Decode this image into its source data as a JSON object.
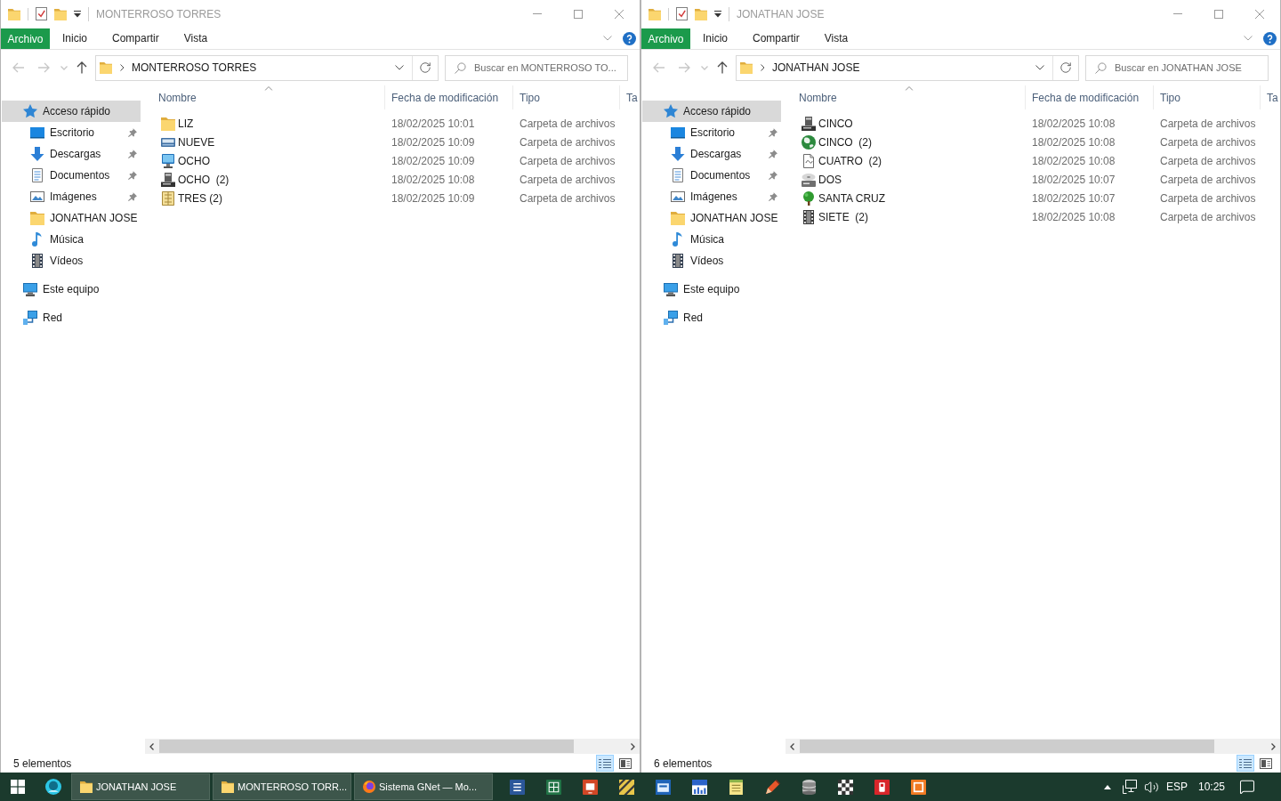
{
  "windows": [
    {
      "title": "MONTERROSO TORRES",
      "active": false,
      "ribbon_tabs": [
        {
          "label": "Archivo",
          "kind": "file"
        },
        {
          "label": "Inicio",
          "kind": "tab"
        },
        {
          "label": "Compartir",
          "kind": "tab"
        },
        {
          "label": "Vista",
          "kind": "tab"
        }
      ],
      "nav_buttons": [
        {
          "kind": "back",
          "disabled": true
        },
        {
          "kind": "forward",
          "disabled": true
        },
        {
          "kind": "recent",
          "disabled": true
        },
        {
          "kind": "up",
          "disabled": false
        }
      ],
      "address": "MONTERROSO TORRES",
      "search": {
        "placeholder": "Buscar en MONTERROSO TO..."
      },
      "navigation": [
        {
          "label": "Acceso rápido",
          "kind": "star",
          "selected": true,
          "children": [
            {
              "label": "Escritorio",
              "kind": "desktop",
              "pinned": true,
              "selected": false
            },
            {
              "label": "Descargas",
              "kind": "downloads",
              "pinned": true,
              "selected": false
            },
            {
              "label": "Documentos",
              "kind": "documents",
              "pinned": true,
              "selected": false
            },
            {
              "label": "Imágenes",
              "kind": "pictures",
              "pinned": true,
              "selected": false
            },
            {
              "label": "JONATHAN JOSE",
              "kind": "folder",
              "pinned": false,
              "selected": false
            },
            {
              "label": "Música",
              "kind": "music",
              "pinned": false,
              "selected": false
            },
            {
              "label": "Vídeos",
              "kind": "videos",
              "pinned": false,
              "selected": false
            }
          ]
        },
        {
          "label": "Este equipo",
          "kind": "pc",
          "selected": false
        },
        {
          "label": "Red",
          "kind": "network",
          "selected": false
        }
      ],
      "columns": [
        {
          "label": "Nombre",
          "sorted": true
        },
        {
          "label": "Fecha de modificación",
          "sorted": false
        },
        {
          "label": "Tipo",
          "sorted": false
        },
        {
          "label": "Ta",
          "sorted": false
        }
      ],
      "rows": [
        {
          "name": "LIZ",
          "kind": "folder",
          "date": "18/02/2025 10:01",
          "type": "Carpeta de archivos"
        },
        {
          "name": "NUEVE",
          "kind": "scanner",
          "date": "18/02/2025 10:09",
          "type": "Carpeta de archivos"
        },
        {
          "name": "OCHO",
          "kind": "monitor",
          "date": "18/02/2025 10:09",
          "type": "Carpeta de archivos"
        },
        {
          "name": "OCHO  (2)",
          "kind": "tower",
          "date": "18/02/2025 10:08",
          "type": "Carpeta de archivos"
        },
        {
          "name": "TRES (2)",
          "kind": "notebook",
          "date": "18/02/2025 10:09",
          "type": "Carpeta de archivos"
        }
      ],
      "status": "5 elementos",
      "view_buttons": [
        {
          "kind": "details",
          "selected": true
        },
        {
          "kind": "tiles",
          "selected": false
        }
      ]
    },
    {
      "title": "JONATHAN JOSE",
      "active": false,
      "ribbon_tabs": [
        {
          "label": "Archivo",
          "kind": "file"
        },
        {
          "label": "Inicio",
          "kind": "tab"
        },
        {
          "label": "Compartir",
          "kind": "tab"
        },
        {
          "label": "Vista",
          "kind": "tab"
        }
      ],
      "nav_buttons": [
        {
          "kind": "back",
          "disabled": true
        },
        {
          "kind": "forward",
          "disabled": true
        },
        {
          "kind": "recent",
          "disabled": true
        },
        {
          "kind": "up",
          "disabled": false
        }
      ],
      "address": "JONATHAN JOSE",
      "search": {
        "placeholder": "Buscar en JONATHAN JOSE"
      },
      "navigation": [
        {
          "label": "Acceso rápido",
          "kind": "star",
          "selected": true,
          "children": [
            {
              "label": "Escritorio",
              "kind": "desktop",
              "pinned": true,
              "selected": false
            },
            {
              "label": "Descargas",
              "kind": "downloads",
              "pinned": true,
              "selected": false
            },
            {
              "label": "Documentos",
              "kind": "documents",
              "pinned": true,
              "selected": false
            },
            {
              "label": "Imágenes",
              "kind": "pictures",
              "pinned": true,
              "selected": false
            },
            {
              "label": "JONATHAN JOSE",
              "kind": "folder",
              "pinned": false,
              "selected": false
            },
            {
              "label": "Música",
              "kind": "music",
              "pinned": false,
              "selected": false
            },
            {
              "label": "Vídeos",
              "kind": "videos",
              "pinned": false,
              "selected": false
            }
          ]
        },
        {
          "label": "Este equipo",
          "kind": "pc",
          "selected": false
        },
        {
          "label": "Red",
          "kind": "network",
          "selected": false
        }
      ],
      "columns": [
        {
          "label": "Nombre",
          "sorted": true
        },
        {
          "label": "Fecha de modificación",
          "sorted": false
        },
        {
          "label": "Tipo",
          "sorted": false
        },
        {
          "label": "Ta",
          "sorted": false
        }
      ],
      "rows": [
        {
          "name": "CINCO",
          "kind": "tower",
          "date": "18/02/2025 10:08",
          "type": "Carpeta de archivos"
        },
        {
          "name": "CINCO  (2)",
          "kind": "globe",
          "date": "18/02/2025 10:08",
          "type": "Carpeta de archivos"
        },
        {
          "name": "CUATRO  (2)",
          "kind": "document",
          "date": "18/02/2025 10:08",
          "type": "Carpeta de archivos"
        },
        {
          "name": "DOS",
          "kind": "drive",
          "date": "18/02/2025 10:07",
          "type": "Carpeta de archivos"
        },
        {
          "name": "SANTA CRUZ",
          "kind": "tree",
          "date": "18/02/2025 10:07",
          "type": "Carpeta de archivos"
        },
        {
          "name": "SIETE  (2)",
          "kind": "film",
          "date": "18/02/2025 10:08",
          "type": "Carpeta de archivos"
        }
      ],
      "status": "6 elementos",
      "view_buttons": [
        {
          "kind": "details",
          "selected": true
        },
        {
          "kind": "tiles",
          "selected": false
        }
      ]
    }
  ],
  "taskbar": {
    "windows": [
      {
        "label": "JONATHAN JOSE",
        "kind": "folder"
      },
      {
        "label": "MONTERROSO TORR...",
        "kind": "folder"
      },
      {
        "label": "Sistema GNet — Mo...",
        "kind": "browser"
      }
    ],
    "language": "ESP",
    "time": "10:25"
  }
}
